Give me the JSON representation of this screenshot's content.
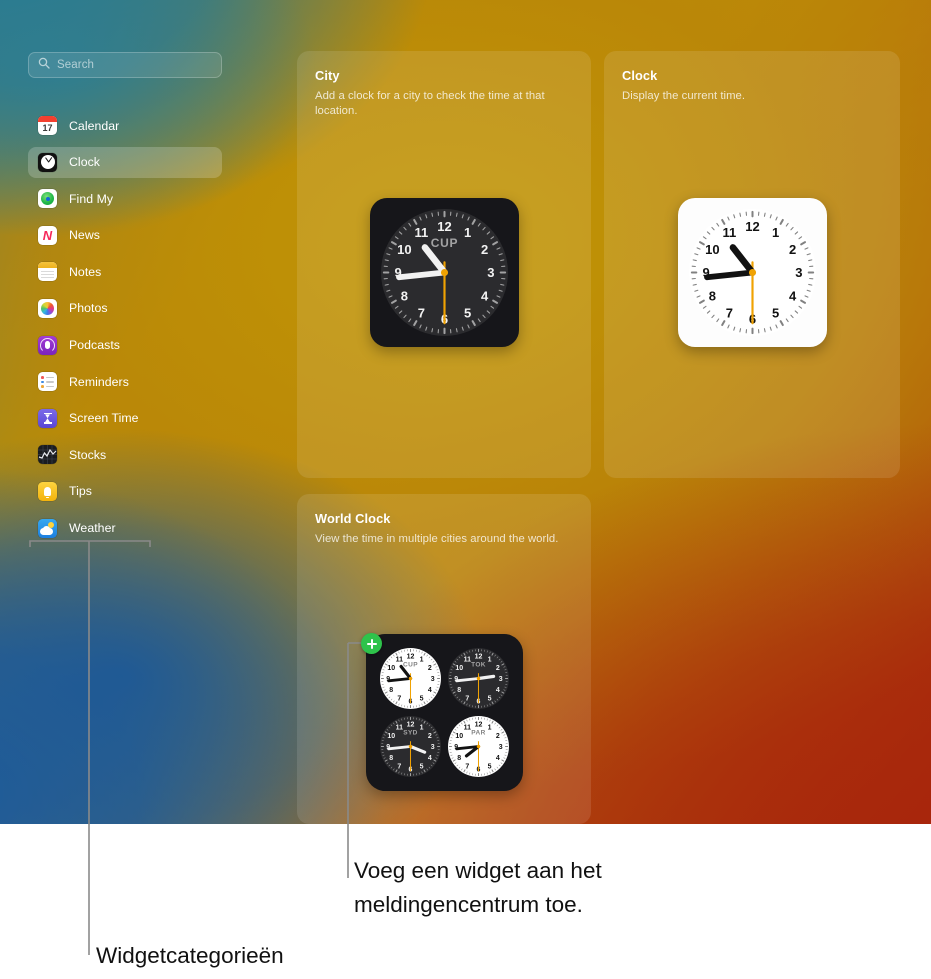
{
  "search": {
    "placeholder": "Search",
    "icon": "search-icon"
  },
  "sidebar": {
    "items": [
      {
        "label": "Calendar",
        "icon": "calendar-app-icon",
        "selected": false,
        "day": "17"
      },
      {
        "label": "Clock",
        "icon": "clock-app-icon",
        "selected": true
      },
      {
        "label": "Find My",
        "icon": "find-my-app-icon",
        "selected": false
      },
      {
        "label": "News",
        "icon": "news-app-icon",
        "selected": false,
        "glyph": "N"
      },
      {
        "label": "Notes",
        "icon": "notes-app-icon",
        "selected": false
      },
      {
        "label": "Photos",
        "icon": "photos-app-icon",
        "selected": false
      },
      {
        "label": "Podcasts",
        "icon": "podcasts-app-icon",
        "selected": false
      },
      {
        "label": "Reminders",
        "icon": "reminders-app-icon",
        "selected": false
      },
      {
        "label": "Screen Time",
        "icon": "screen-time-app-icon",
        "selected": false
      },
      {
        "label": "Stocks",
        "icon": "stocks-app-icon",
        "selected": false
      },
      {
        "label": "Tips",
        "icon": "tips-app-icon",
        "selected": false
      },
      {
        "label": "Weather",
        "icon": "weather-app-icon",
        "selected": false
      }
    ]
  },
  "cards": [
    {
      "title": "City",
      "desc": "Add a clock for a city to check the time at that location."
    },
    {
      "title": "Clock",
      "desc": "Display the current time."
    },
    {
      "title": "World Clock",
      "desc": "View the time in multiple cities around the world."
    }
  ],
  "widgets": {
    "city": {
      "style": "dark",
      "city_label": "CUP",
      "hour": 10,
      "minute": 44,
      "second": 30
    },
    "clock": {
      "style": "light",
      "city_label": "",
      "hour": 10,
      "minute": 44,
      "second": 30
    },
    "world": {
      "add_badge": "plus-badge",
      "clocks": [
        {
          "city_label": "CUP",
          "style": "light",
          "hour": 10,
          "minute": 44,
          "second": 30
        },
        {
          "city_label": "TOK",
          "style": "dark",
          "hour": 2,
          "minute": 44,
          "second": 30
        },
        {
          "city_label": "SYD",
          "style": "dark",
          "hour": 3,
          "minute": 44,
          "second": 30
        },
        {
          "city_label": "PAR",
          "style": "light",
          "hour": 7,
          "minute": 44,
          "second": 30
        }
      ]
    }
  },
  "clock_numerals": [
    "12",
    "1",
    "2",
    "3",
    "4",
    "5",
    "6",
    "7",
    "8",
    "9",
    "10",
    "11"
  ],
  "callouts": {
    "widget": "Voeg een widget aan het meldingencentrum toe.",
    "categories": "Widgetcategorieën"
  },
  "colors": {
    "accent_green": "#2ec34b",
    "second_hand": "#f0a202",
    "callout_line": "#8a8a8a",
    "callout_text": "#111111"
  }
}
